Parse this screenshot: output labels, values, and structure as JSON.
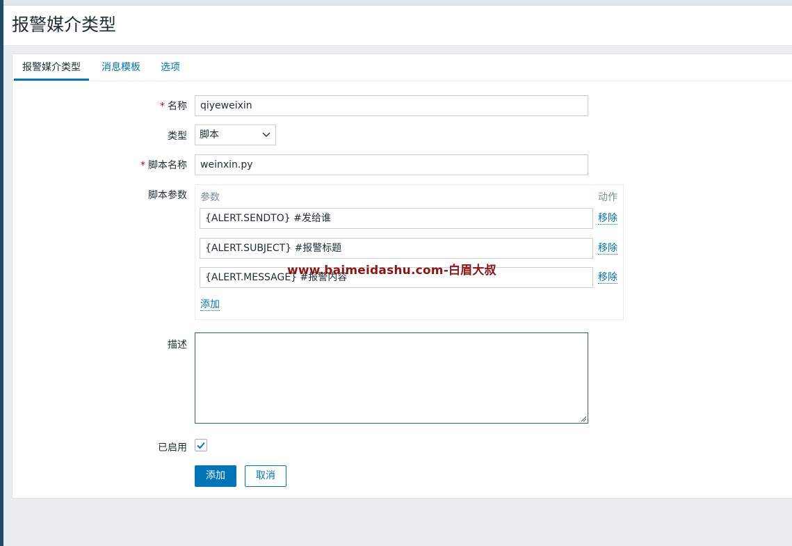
{
  "page": {
    "title": "报警媒介类型"
  },
  "tabs": [
    {
      "label": "报警媒介类型",
      "active": true
    },
    {
      "label": "消息模板",
      "active": false
    },
    {
      "label": "选项",
      "active": false
    }
  ],
  "form": {
    "name": {
      "label": "名称",
      "required": true,
      "value": "qiyeweixin"
    },
    "type": {
      "label": "类型",
      "selected": "脚本"
    },
    "script_name": {
      "label": "脚本名称",
      "required": true,
      "value": "weinxin.py"
    },
    "script_params": {
      "label": "脚本参数",
      "col_param": "参数",
      "col_action": "动作",
      "rows": [
        {
          "value": "{ALERT.SENDTO}  #发给谁",
          "remove": "移除"
        },
        {
          "value": "{ALERT.SUBJECT} #报警标题",
          "remove": "移除"
        },
        {
          "value": "{ALERT.MESSAGE} #报警内容",
          "remove": "移除"
        }
      ],
      "add": "添加"
    },
    "description": {
      "label": "描述",
      "value": ""
    },
    "enabled": {
      "label": "已启用",
      "checked": true
    },
    "buttons": {
      "add": "添加",
      "cancel": "取消"
    }
  },
  "watermark": "www.baimeidashu.com-白眉大叔",
  "colors": {
    "accent": "#0275b8",
    "required": "#d40000",
    "watermark": "#8a1515"
  }
}
